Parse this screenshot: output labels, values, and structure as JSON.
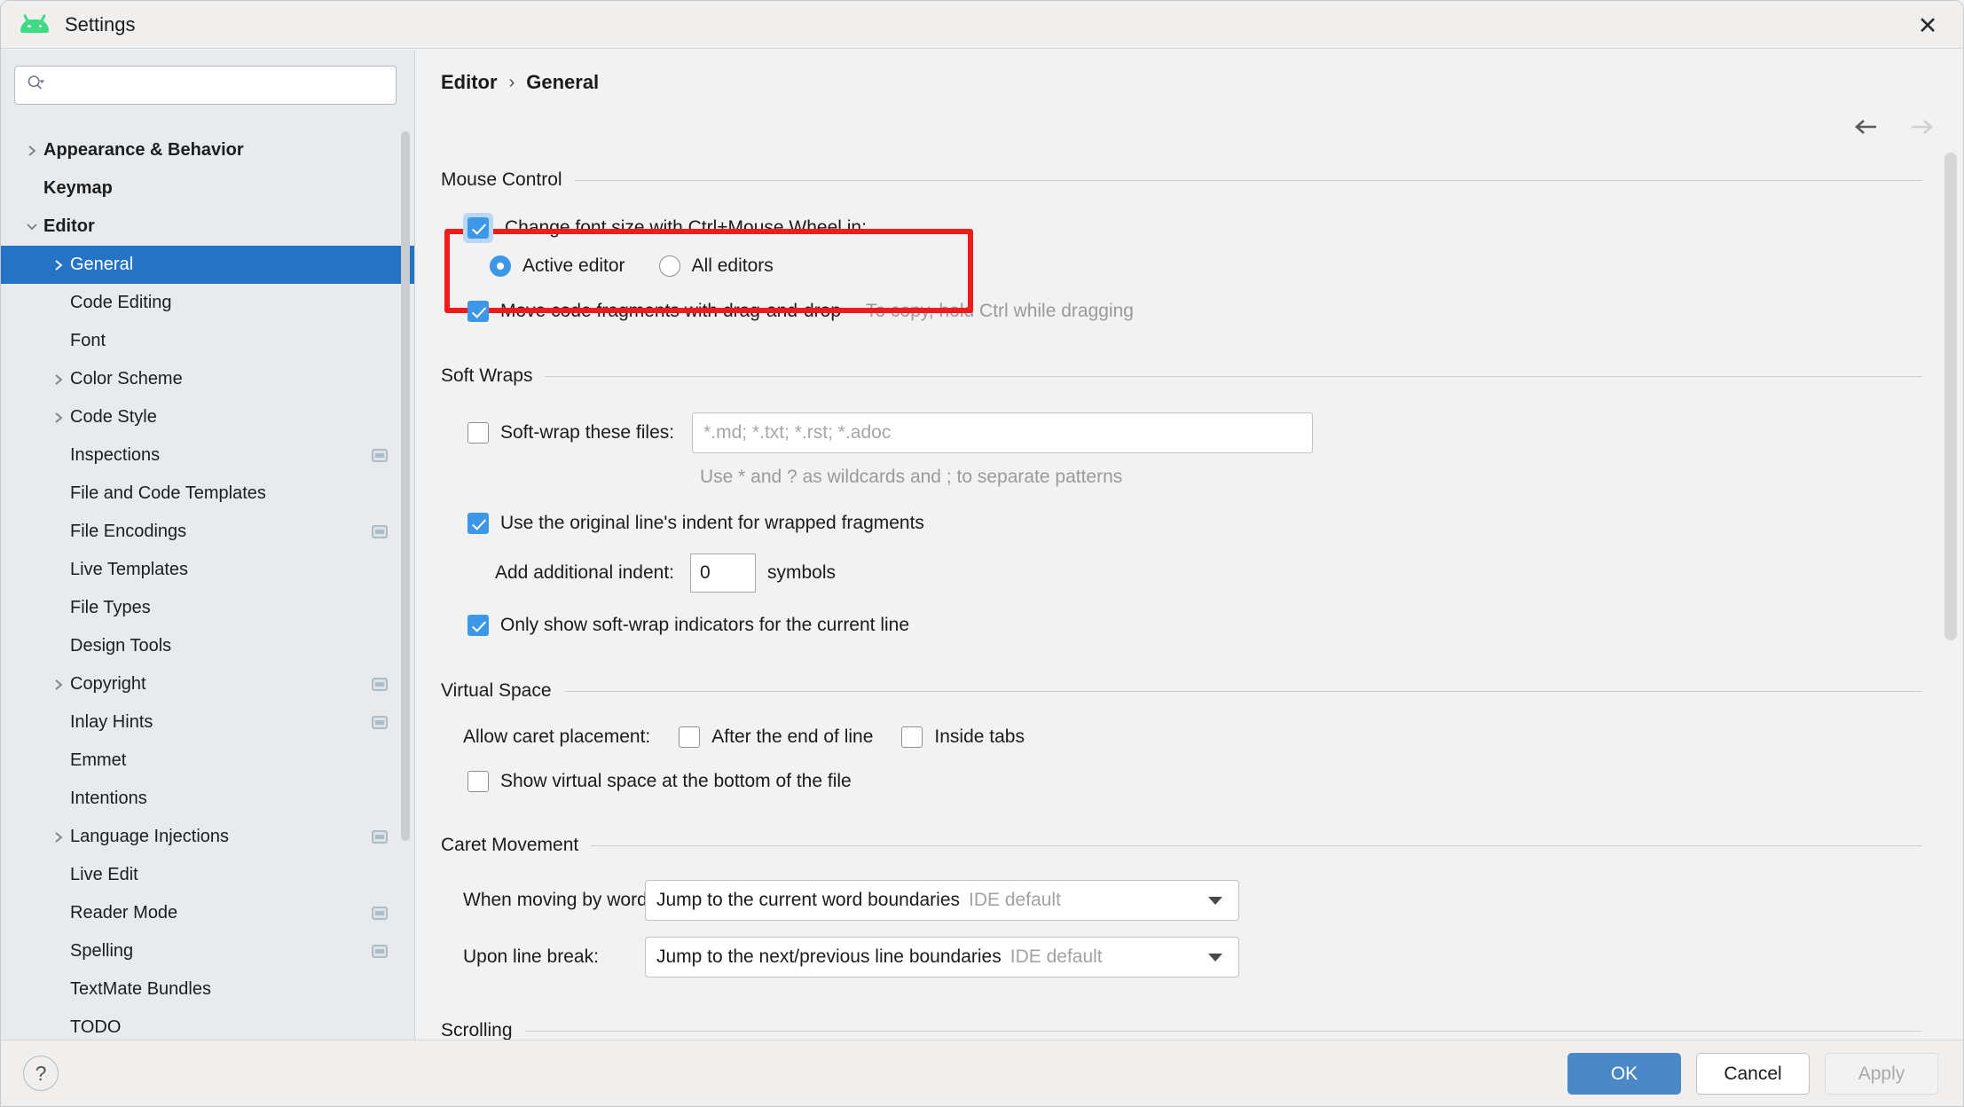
{
  "window": {
    "title": "Settings",
    "app_icon": "android-robot-icon",
    "close_label": "✕",
    "accent_color": "#2473c5",
    "android_green": "#3ddc84",
    "highlight_color": "#f01c1c"
  },
  "sidebar": {
    "search": {
      "placeholder": "",
      "value": "",
      "icon": "search-icon"
    },
    "items": [
      {
        "label": "Appearance & Behavior",
        "indent": 0,
        "bold": true,
        "twisty": "right",
        "selected": false,
        "badge": false
      },
      {
        "label": "Keymap",
        "indent": 0,
        "bold": true,
        "twisty": "none",
        "selected": false,
        "badge": false
      },
      {
        "label": "Editor",
        "indent": 0,
        "bold": true,
        "twisty": "down",
        "selected": false,
        "badge": false
      },
      {
        "label": "General",
        "indent": 1,
        "bold": false,
        "twisty": "right",
        "selected": true,
        "badge": false
      },
      {
        "label": "Code Editing",
        "indent": 1,
        "bold": false,
        "twisty": "none",
        "selected": false,
        "badge": false
      },
      {
        "label": "Font",
        "indent": 1,
        "bold": false,
        "twisty": "none",
        "selected": false,
        "badge": false
      },
      {
        "label": "Color Scheme",
        "indent": 1,
        "bold": false,
        "twisty": "right",
        "selected": false,
        "badge": false
      },
      {
        "label": "Code Style",
        "indent": 1,
        "bold": false,
        "twisty": "right",
        "selected": false,
        "badge": false
      },
      {
        "label": "Inspections",
        "indent": 1,
        "bold": false,
        "twisty": "none",
        "selected": false,
        "badge": true
      },
      {
        "label": "File and Code Templates",
        "indent": 1,
        "bold": false,
        "twisty": "none",
        "selected": false,
        "badge": false
      },
      {
        "label": "File Encodings",
        "indent": 1,
        "bold": false,
        "twisty": "none",
        "selected": false,
        "badge": true
      },
      {
        "label": "Live Templates",
        "indent": 1,
        "bold": false,
        "twisty": "none",
        "selected": false,
        "badge": false
      },
      {
        "label": "File Types",
        "indent": 1,
        "bold": false,
        "twisty": "none",
        "selected": false,
        "badge": false
      },
      {
        "label": "Design Tools",
        "indent": 1,
        "bold": false,
        "twisty": "none",
        "selected": false,
        "badge": false
      },
      {
        "label": "Copyright",
        "indent": 1,
        "bold": false,
        "twisty": "right",
        "selected": false,
        "badge": true
      },
      {
        "label": "Inlay Hints",
        "indent": 1,
        "bold": false,
        "twisty": "none",
        "selected": false,
        "badge": true
      },
      {
        "label": "Emmet",
        "indent": 1,
        "bold": false,
        "twisty": "none",
        "selected": false,
        "badge": false
      },
      {
        "label": "Intentions",
        "indent": 1,
        "bold": false,
        "twisty": "none",
        "selected": false,
        "badge": false
      },
      {
        "label": "Language Injections",
        "indent": 1,
        "bold": false,
        "twisty": "right",
        "selected": false,
        "badge": true
      },
      {
        "label": "Live Edit",
        "indent": 1,
        "bold": false,
        "twisty": "none",
        "selected": false,
        "badge": false
      },
      {
        "label": "Reader Mode",
        "indent": 1,
        "bold": false,
        "twisty": "none",
        "selected": false,
        "badge": true
      },
      {
        "label": "Spelling",
        "indent": 1,
        "bold": false,
        "twisty": "none",
        "selected": false,
        "badge": true
      },
      {
        "label": "TextMate Bundles",
        "indent": 1,
        "bold": false,
        "twisty": "none",
        "selected": false,
        "badge": false
      },
      {
        "label": "TODO",
        "indent": 1,
        "bold": false,
        "twisty": "none",
        "selected": false,
        "badge": false
      }
    ]
  },
  "content": {
    "breadcrumb": {
      "parent": "Editor",
      "separator": "›",
      "current": "General"
    },
    "nav": {
      "back": "back-arrow",
      "forward": "forward-arrow",
      "back_enabled": true,
      "forward_enabled": false
    },
    "mouse_control": {
      "title": "Mouse Control",
      "change_font_size": {
        "label": "Change font size with Ctrl+Mouse Wheel in:",
        "checked": true,
        "focused": true
      },
      "scope_options": [
        {
          "label": "Active editor",
          "selected": true
        },
        {
          "label": "All editors",
          "selected": false
        }
      ],
      "drag_and_drop": {
        "label": "Move code fragments with drag-and-drop",
        "checked": true
      },
      "drag_and_drop_hint": "To copy, hold Ctrl while dragging"
    },
    "soft_wraps": {
      "title": "Soft Wraps",
      "soft_wrap_files": {
        "label": "Soft-wrap these files:",
        "checked": false,
        "placeholder": "*.md; *.txt; *.rst; *.adoc",
        "value": ""
      },
      "wildcard_hint": "Use * and ? as wildcards and ; to separate patterns",
      "original_indent": {
        "label": "Use the original line's indent for wrapped fragments",
        "checked": true
      },
      "additional_indent": {
        "label": "Add additional indent:",
        "value": "0",
        "unit": "symbols"
      },
      "indicators_current_line": {
        "label": "Only show soft-wrap indicators for the current line",
        "checked": true
      }
    },
    "virtual_space": {
      "title": "Virtual Space",
      "caret_placement_label": "Allow caret placement:",
      "caret_options": [
        {
          "label": "After the end of line",
          "checked": false
        },
        {
          "label": "Inside tabs",
          "checked": false
        }
      ],
      "show_virtual_space": {
        "label": "Show virtual space at the bottom of the file",
        "checked": false
      }
    },
    "caret_movement": {
      "title": "Caret Movement",
      "rows": [
        {
          "label": "When moving by words:",
          "value": "Jump to the current word boundaries",
          "suffix": "IDE default"
        },
        {
          "label": "Upon line break:",
          "value": "Jump to the next/previous line boundaries",
          "suffix": "IDE default"
        }
      ]
    },
    "scrolling": {
      "title": "Scrolling"
    }
  },
  "footer": {
    "help_label": "?",
    "ok_label": "OK",
    "cancel_label": "Cancel",
    "apply_label": "Apply"
  }
}
